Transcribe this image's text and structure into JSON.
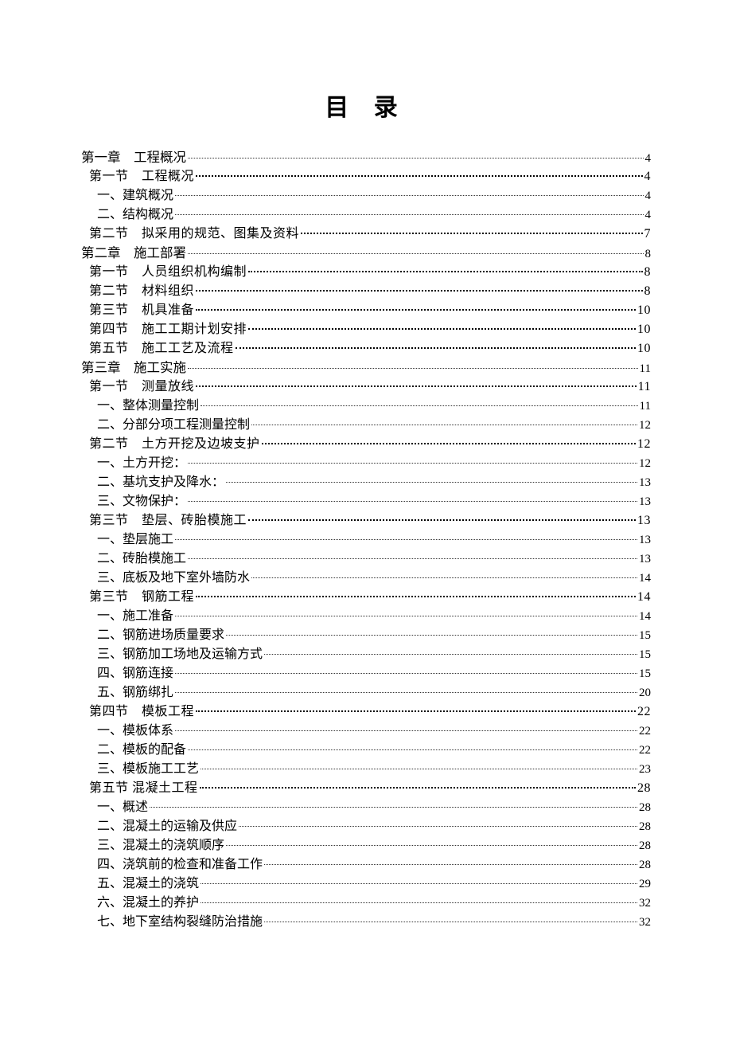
{
  "title": "目 录",
  "entries": [
    {
      "level": 0,
      "label": "第一章　工程概况",
      "page": "4"
    },
    {
      "level": 1,
      "label": "第一节　工程概况 ",
      "page": " 4"
    },
    {
      "level": 2,
      "label": "一、建筑概况 ",
      "page": "4"
    },
    {
      "level": 2,
      "label": "二、结构概况 ",
      "page": "4"
    },
    {
      "level": 1,
      "label": "第二节　拟采用的规范、图集及资料 ",
      "page": " 7"
    },
    {
      "level": 0,
      "label": "第二章　施工部署",
      "page": "8"
    },
    {
      "level": 1,
      "label": "第一节　人员组织机构编制 ",
      "page": " 8"
    },
    {
      "level": 1,
      "label": "第二节　材料组织 ",
      "page": " 8"
    },
    {
      "level": 1,
      "label": "第三节　机具准备 ",
      "page": " 10"
    },
    {
      "level": 1,
      "label": "第四节　施工工期计划安排 ",
      "page": " 10"
    },
    {
      "level": 1,
      "label": "第五节　施工工艺及流程 ",
      "page": " 10"
    },
    {
      "level": 0,
      "label": "第三章　施工实施",
      "page": "11"
    },
    {
      "level": 1,
      "label": "第一节　测量放线 ",
      "page": " 11"
    },
    {
      "level": 2,
      "label": "一、整体测量控制 ",
      "page": "11"
    },
    {
      "level": 2,
      "label": "二、分部分项工程测量控制 ",
      "page": "12"
    },
    {
      "level": 1,
      "label": "第二节　土方开挖及边坡支护 ",
      "page": " 12"
    },
    {
      "level": 2,
      "label": "一、土方开挖： ",
      "page": "12"
    },
    {
      "level": 2,
      "label": "二、基坑支护及降水： ",
      "page": "13"
    },
    {
      "level": 2,
      "label": "三、文物保护： ",
      "page": "13"
    },
    {
      "level": 1,
      "label": "第三节　垫层、砖胎模施工 ",
      "page": " 13"
    },
    {
      "level": 2,
      "label": "一、垫层施工 ",
      "page": "13"
    },
    {
      "level": 2,
      "label": "二、砖胎模施工 ",
      "page": "13"
    },
    {
      "level": 2,
      "label": "三、底板及地下室外墙防水 ",
      "page": "14"
    },
    {
      "level": 1,
      "label": "第三节　钢筋工程 ",
      "page": " 14"
    },
    {
      "level": 2,
      "label": "一、施工准备 ",
      "page": "14"
    },
    {
      "level": 2,
      "label": "二、钢筋进场质量要求 ",
      "page": "15"
    },
    {
      "level": 2,
      "label": "三、钢筋加工场地及运输方式 ",
      "page": "15"
    },
    {
      "level": 2,
      "label": "四、钢筋连接 ",
      "page": "15"
    },
    {
      "level": 2,
      "label": "五、钢筋绑扎 ",
      "page": "20"
    },
    {
      "level": 1,
      "label": "第四节　模板工程 ",
      "page": " 22"
    },
    {
      "level": 2,
      "label": "一、模板体系 ",
      "page": "22"
    },
    {
      "level": 2,
      "label": "二、模板的配备 ",
      "page": "22"
    },
    {
      "level": 2,
      "label": "三、模板施工工艺 ",
      "page": "23"
    },
    {
      "level": 1,
      "label": "第五节 混凝土工程 ",
      "page": " 28"
    },
    {
      "level": 2,
      "label": "一、概述 ",
      "page": "28"
    },
    {
      "level": 2,
      "label": "二、混凝土的运输及供应 ",
      "page": "28"
    },
    {
      "level": 2,
      "label": "三、混凝土的浇筑顺序 ",
      "page": "28"
    },
    {
      "level": 2,
      "label": "四、浇筑前的检查和准备工作 ",
      "page": "28"
    },
    {
      "level": 2,
      "label": "五、混凝土的浇筑 ",
      "page": "29"
    },
    {
      "level": 2,
      "label": "六、混凝土的养护 ",
      "page": "32"
    },
    {
      "level": 2,
      "label": "七、地下室结构裂缝防治措施 ",
      "page": "32"
    }
  ]
}
